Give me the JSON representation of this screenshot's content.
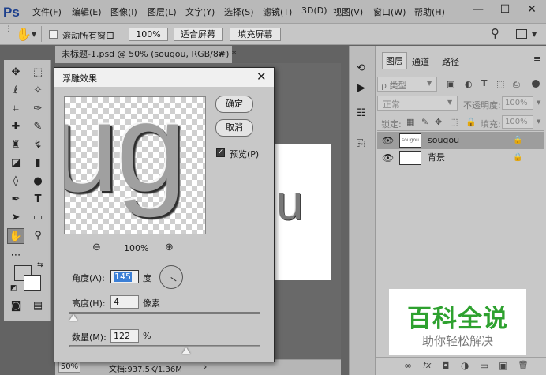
{
  "app": {
    "logo": "Ps"
  },
  "menu": [
    "文件(F)",
    "编辑(E)",
    "图像(I)",
    "图层(L)",
    "文字(Y)",
    "选择(S)",
    "滤镜(T)",
    "3D(D)",
    "视图(V)",
    "窗口(W)",
    "帮助(H)"
  ],
  "window_controls": [
    "—",
    "☐",
    "✕"
  ],
  "options_bar": {
    "scroll_all_label": "滚动所有窗口",
    "zoom_value": "100%",
    "fit_screen": "适合屏幕",
    "fill_screen": "填充屏幕"
  },
  "document": {
    "tab_title": "未标题-1.psd @ 50% (sougou, RGB/8#) *",
    "tab_close": "×",
    "canvas_text": "u",
    "status_zoom": "50%",
    "status_info": "文档:937.5K/1.36M",
    "status_arrow": "›"
  },
  "dialog": {
    "title": "浮雕效果",
    "close": "✕",
    "preview_text": "ug",
    "preview_zoom": "100%",
    "zoom_out_icon": "⊖",
    "zoom_in_icon": "⊕",
    "ok": "确定",
    "cancel": "取消",
    "preview_label": "预览(P)",
    "preview_checked": true,
    "angle_label": "角度(A):",
    "angle_value": "145",
    "angle_unit": "度",
    "height_label": "高度(H):",
    "height_value": "4",
    "height_unit": "像素",
    "height_slider": 0.02,
    "amount_label": "数量(M):",
    "amount_value": "122",
    "amount_unit": "%",
    "amount_slider": 0.61
  },
  "panels": {
    "tabs": [
      "图层",
      "通道",
      "路径"
    ],
    "filter_kind": "ρ 类型",
    "blend_mode": "正常",
    "opacity_label": "不透明度:",
    "opacity_value": "100%",
    "lock_label": "锁定:",
    "fill_label": "填充:",
    "fill_value": "100%",
    "layers": [
      {
        "name": "sougou",
        "thumb": "sougou",
        "selected": true
      },
      {
        "name": "背景",
        "thumb": "",
        "selected": false
      }
    ],
    "footer_icons": [
      "∞",
      "fx",
      "◘",
      "◑",
      "▭",
      "▣",
      "🗑"
    ]
  },
  "watermark": {
    "title": "百科全说",
    "subtitle": "助你轻松解决"
  },
  "colors": {
    "accent_green": "#2ea12f",
    "ps_blue": "#1c3f8c",
    "selection": "#3b7fd6"
  }
}
